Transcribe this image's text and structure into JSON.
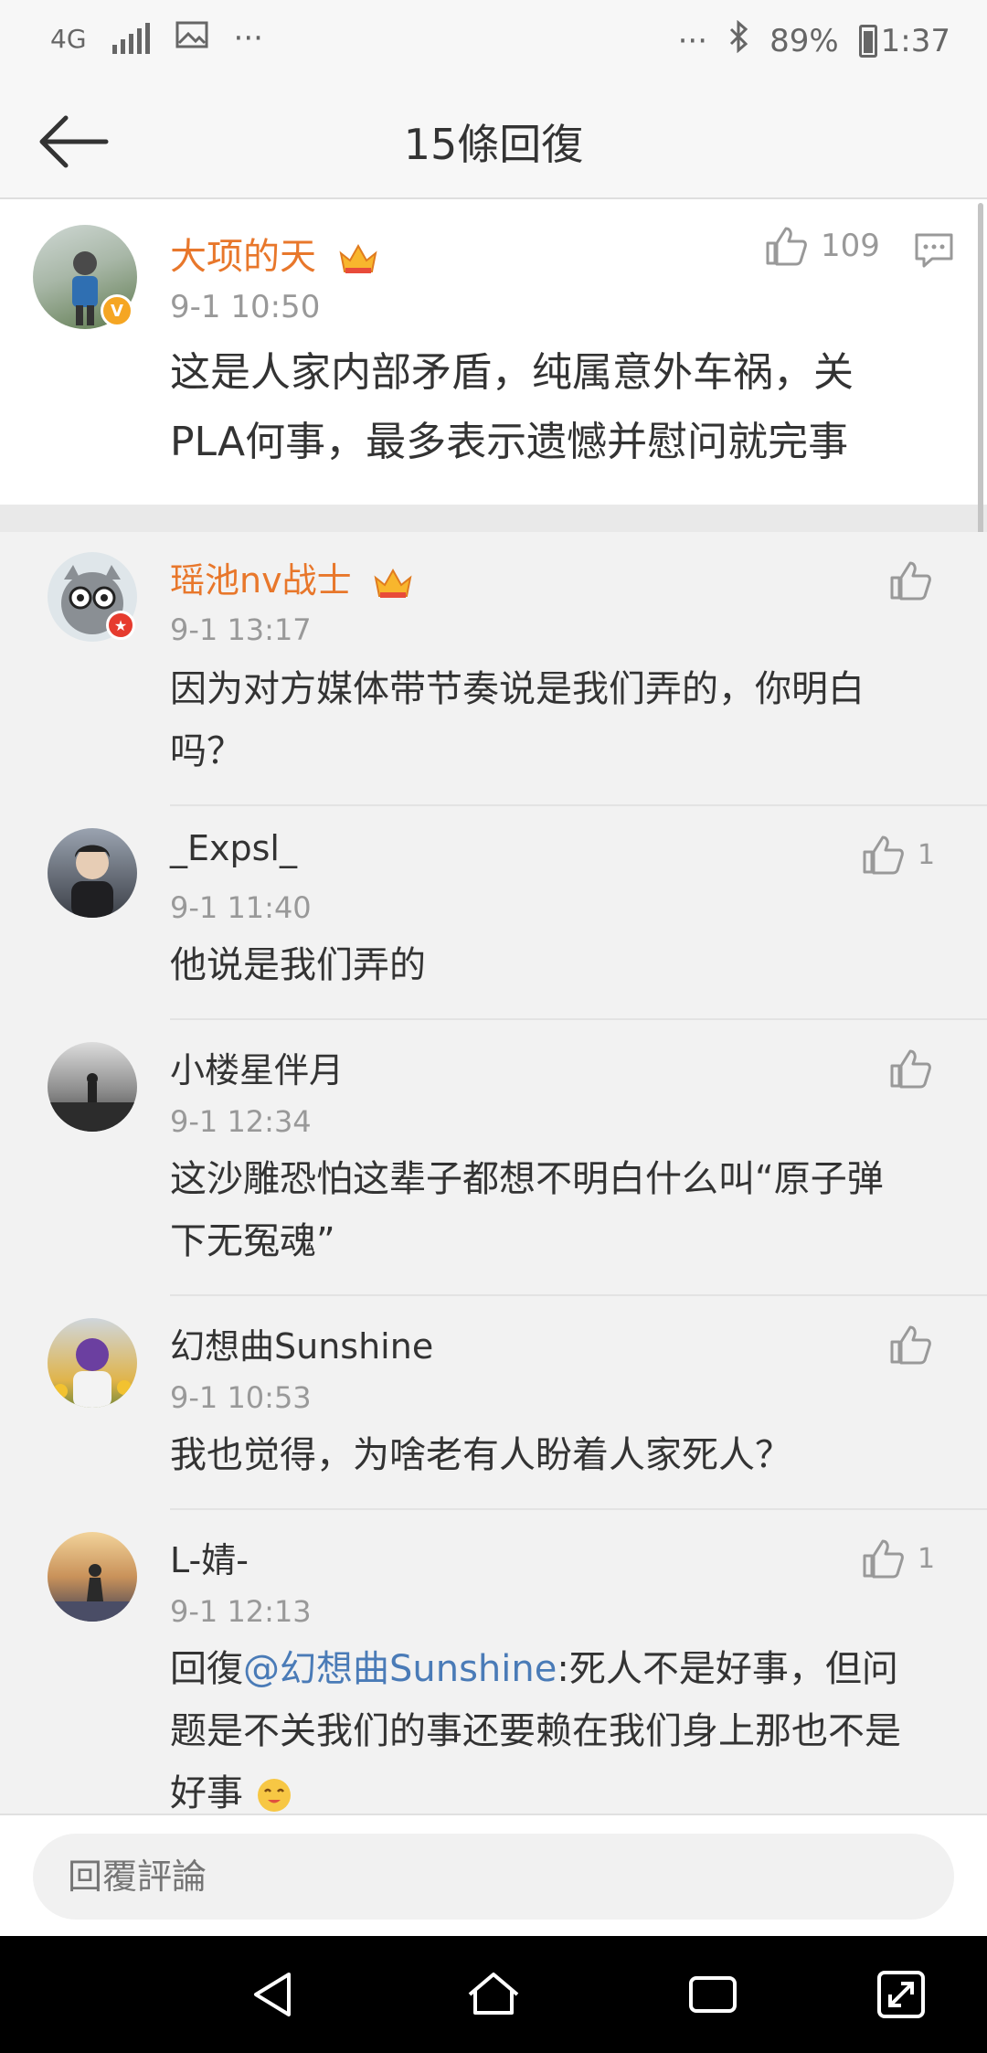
{
  "status_bar": {
    "network": "4G",
    "more_left": "···",
    "more_right": "···",
    "battery": "89%",
    "time": "1:37"
  },
  "header": {
    "title": "15條回復"
  },
  "main_comment": {
    "author": "大项的天",
    "time": "9-1 10:50",
    "likes": "109",
    "text_line1": "这是人家内部矛盾，纯属意外车祸，关",
    "text_line2": "PLA何事，最多表示遗憾并慰问就完事",
    "verified_badge": "V",
    "accent_color": "#e8772b"
  },
  "replies": [
    {
      "author": "瑶池nv战士",
      "time": "9-1 13:17",
      "likes": "",
      "text_line1": "因为对方媒体带节奏说是我们弄的，你明白",
      "text_line2": "吗？"
    },
    {
      "author": "_Expsl_",
      "time": "9-1 11:40",
      "likes": "1",
      "text_line1": "他说是我们弄的"
    },
    {
      "author": "小楼星伴月",
      "time": "9-1 12:34",
      "likes": "",
      "text_line1": "这沙雕恐怕这辈子都想不明白什么叫“原子弹",
      "text_line2": "下无冤魂”"
    },
    {
      "author": "幻想曲Sunshine",
      "time": "9-1 10:53",
      "likes": "",
      "text_line1": "我也觉得，为啥老有人盼着人家死人？"
    },
    {
      "author": "L-婧-",
      "time": "9-1 12:13",
      "likes": "1",
      "reply_prefix": "回復",
      "mention": "@幻想曲Sunshine",
      "text_after_mention": ":死人不是好事，但问",
      "text_line2": "题是不关我们的事还要赖在我们身上那也不是",
      "text_line3": "好事"
    }
  ],
  "reply_bar": {
    "placeholder": "回覆評論"
  }
}
